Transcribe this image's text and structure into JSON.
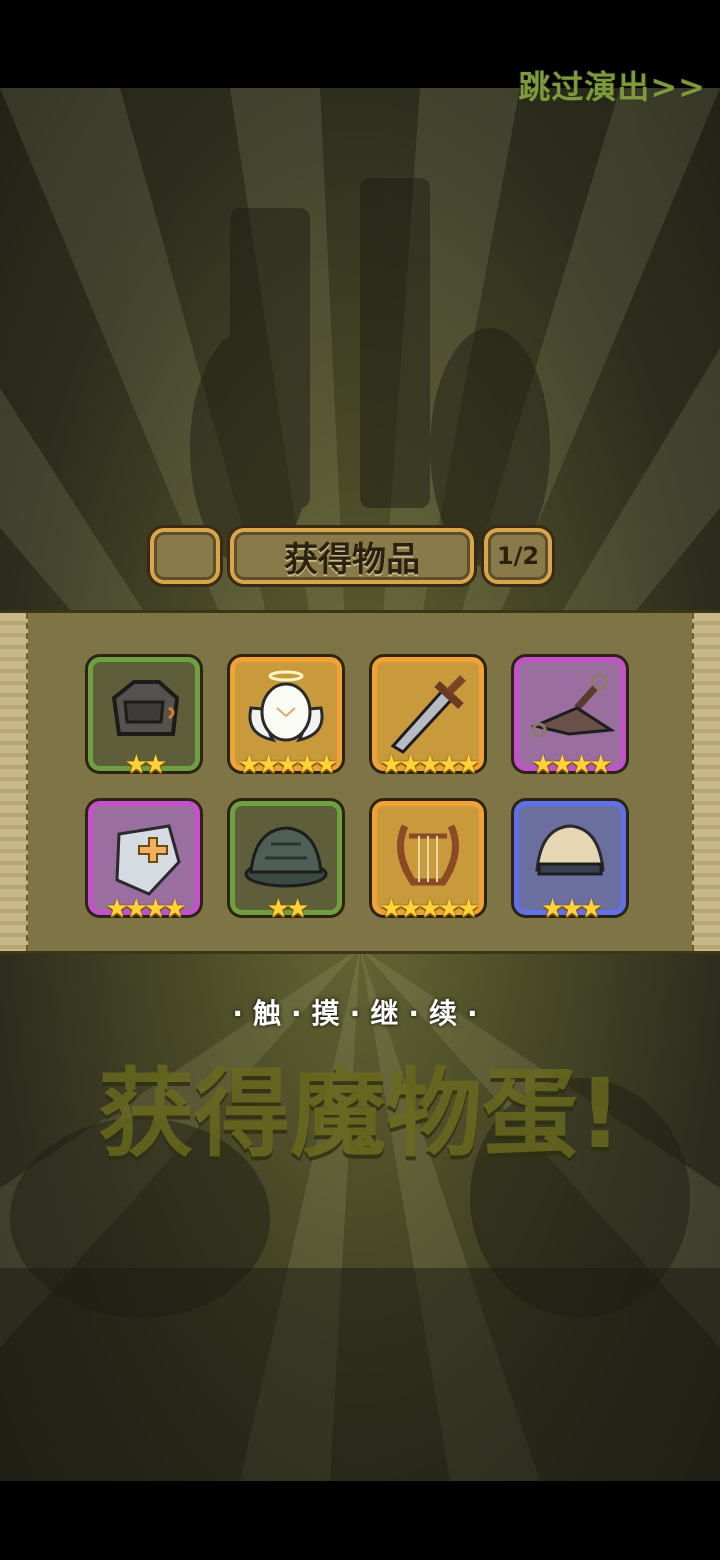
{
  "skip_label": "跳过演出>>",
  "header": {
    "title": "获得物品",
    "page": "1/2"
  },
  "background_text": "获得魔物蛋!",
  "touch_hint": "·触·摸·继·续·",
  "colors": {
    "green": "#6ea040",
    "orange": "#f0a236",
    "purple": "#c64fcb",
    "blue": "#6070e8",
    "star": "#ffd23a"
  },
  "items": [
    {
      "icon": "stone-armor-icon",
      "rarity": "green",
      "stars": 2,
      "stars_text": "★★"
    },
    {
      "icon": "angel-egg-icon",
      "rarity": "orange",
      "stars": 5,
      "stars_text": "★★★★★"
    },
    {
      "icon": "sword-icon",
      "rarity": "orange",
      "stars": 5,
      "stars_text": "★★★★★"
    },
    {
      "icon": "kunai-icon",
      "rarity": "purple",
      "stars": 4,
      "stars_text": "★★★★"
    },
    {
      "icon": "shield-icon",
      "rarity": "purple",
      "stars": 4,
      "stars_text": "★★★★"
    },
    {
      "icon": "turtle-shell-icon",
      "rarity": "green",
      "stars": 2,
      "stars_text": "★★"
    },
    {
      "icon": "lyre-icon",
      "rarity": "orange",
      "stars": 5,
      "stars_text": "★★★★★"
    },
    {
      "icon": "fur-hat-icon",
      "rarity": "blue",
      "stars": 3,
      "stars_text": "★★★"
    }
  ]
}
